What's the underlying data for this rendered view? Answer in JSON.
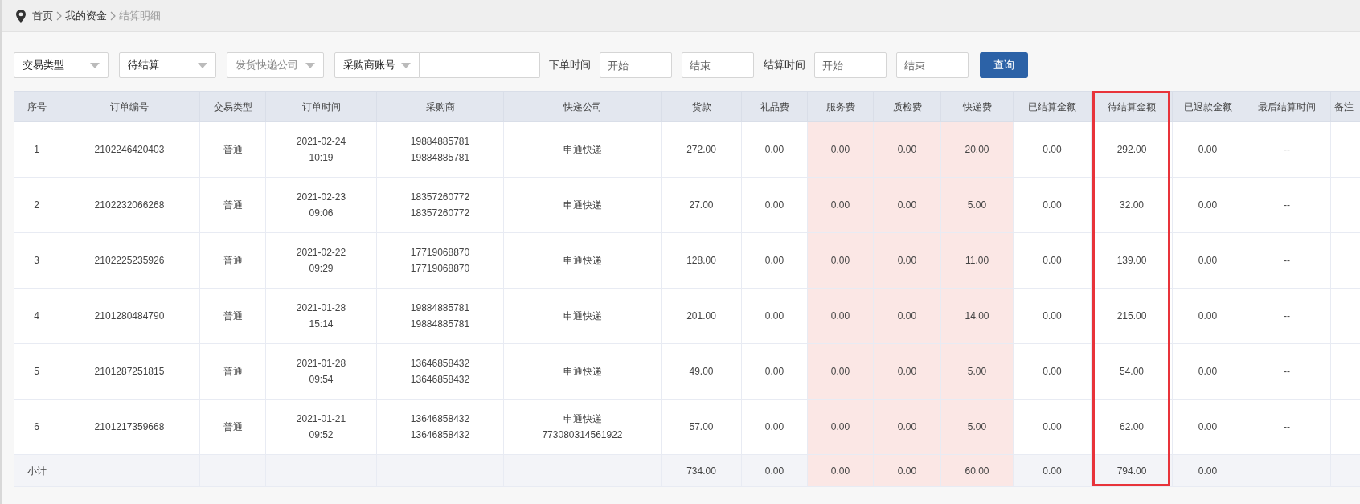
{
  "breadcrumb": [
    {
      "label": "首页",
      "current": false
    },
    {
      "label": "我的资金",
      "current": false
    },
    {
      "label": "结算明细",
      "current": true
    }
  ],
  "filters": {
    "selects": [
      {
        "value": "交易类型"
      },
      {
        "value": "待结算"
      },
      {
        "placeholder": "发货快递公司"
      }
    ],
    "account": {
      "select": "采购商账号"
    },
    "ranges": [
      {
        "label": "下单时间",
        "start": {
          "placeholder": "开始"
        },
        "end": {
          "placeholder": "结束"
        }
      },
      {
        "label": "结算时间",
        "start": {
          "placeholder": "开始"
        },
        "end": {
          "placeholder": "结束"
        }
      }
    ],
    "button": "查询"
  },
  "table": {
    "columns": [
      {
        "label": "序号",
        "shaded": false,
        "highlighted": false
      },
      {
        "label": "订单编号",
        "shaded": false,
        "highlighted": false
      },
      {
        "label": "交易类型",
        "shaded": false,
        "highlighted": false
      },
      {
        "label": "订单时间",
        "shaded": false,
        "highlighted": false
      },
      {
        "label": "采购商",
        "shaded": false,
        "highlighted": false
      },
      {
        "label": "快递公司",
        "shaded": false,
        "highlighted": false
      },
      {
        "label": "货款",
        "shaded": false,
        "highlighted": false
      },
      {
        "label": "礼品费",
        "shaded": false,
        "highlighted": false
      },
      {
        "label": "服务费",
        "shaded": true,
        "highlighted": false
      },
      {
        "label": "质检费",
        "shaded": true,
        "highlighted": false
      },
      {
        "label": "快递费",
        "shaded": true,
        "highlighted": false
      },
      {
        "label": "已结算金额",
        "shaded": false,
        "highlighted": false
      },
      {
        "label": "待结算金额",
        "shaded": false,
        "highlighted": true
      },
      {
        "label": "已退款金额",
        "shaded": false,
        "highlighted": false
      },
      {
        "label": "最后结算时间",
        "shaded": false,
        "highlighted": false
      },
      {
        "label": "备注",
        "shaded": false,
        "highlighted": false
      }
    ],
    "rows": [
      [
        "1",
        "2102246420403",
        "普通",
        "2021-02-24\n10:19",
        "19884885781\n19884885781",
        "申通快递",
        "272.00",
        "0.00",
        "0.00",
        "0.00",
        "20.00",
        "0.00",
        "292.00",
        "0.00",
        "--"
      ],
      [
        "2",
        "2102232066268",
        "普通",
        "2021-02-23\n09:06",
        "18357260772\n18357260772",
        "申通快递",
        "27.00",
        "0.00",
        "0.00",
        "0.00",
        "5.00",
        "0.00",
        "32.00",
        "0.00",
        "--"
      ],
      [
        "3",
        "2102225235926",
        "普通",
        "2021-02-22\n09:29",
        "17719068870\n17719068870",
        "申通快递",
        "128.00",
        "0.00",
        "0.00",
        "0.00",
        "11.00",
        "0.00",
        "139.00",
        "0.00",
        "--"
      ],
      [
        "4",
        "2101280484790",
        "普通",
        "2021-01-28\n15:14",
        "19884885781\n19884885781",
        "申通快递",
        "201.00",
        "0.00",
        "0.00",
        "0.00",
        "14.00",
        "0.00",
        "215.00",
        "0.00",
        "--"
      ],
      [
        "5",
        "2101287251815",
        "普通",
        "2021-01-28\n09:54",
        "13646858432\n13646858432",
        "申通快递",
        "49.00",
        "0.00",
        "0.00",
        "0.00",
        "5.00",
        "0.00",
        "54.00",
        "0.00",
        "--"
      ],
      [
        "6",
        "2101217359668",
        "普通",
        "2021-01-21\n09:52",
        "13646858432\n13646858432",
        "申通快递\n773080314561922",
        "57.00",
        "0.00",
        "0.00",
        "0.00",
        "5.00",
        "0.00",
        "62.00",
        "0.00",
        "--"
      ]
    ],
    "subtotal": {
      "label": "小计",
      "amounts": [
        "734.00",
        "0.00",
        "0.00",
        "0.00",
        "60.00",
        "0.00",
        "794.00",
        "0.00"
      ]
    }
  }
}
